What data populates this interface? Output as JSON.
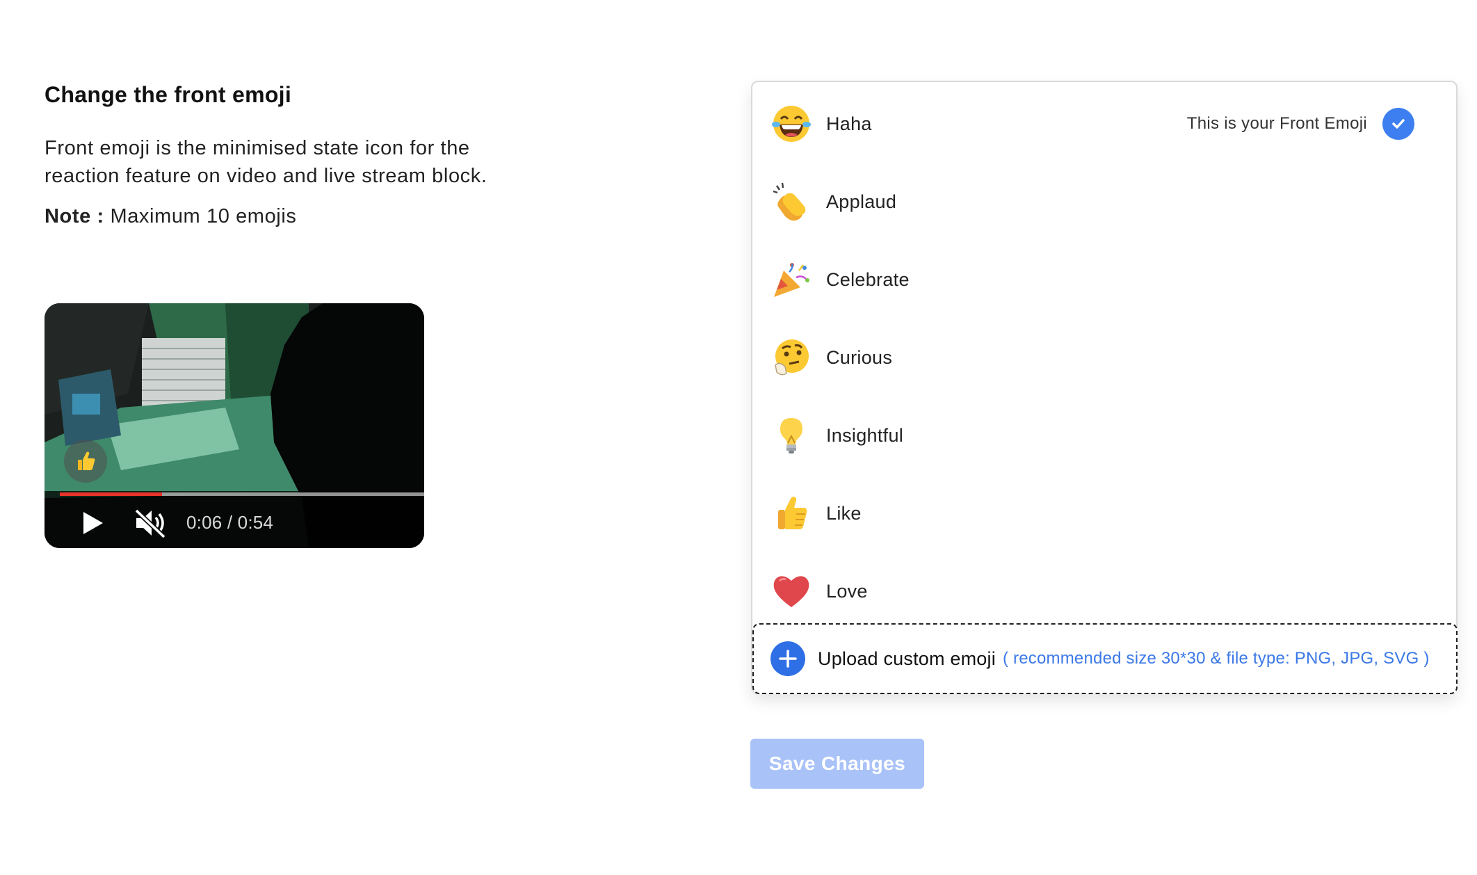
{
  "section": {
    "title": "Change the front emoji",
    "description": "Front emoji is the minimised state icon for the reaction feature on video and live stream block.",
    "note_label": "Note :",
    "note_text": "Maximum 10 emojis"
  },
  "video": {
    "current_time": "0:06",
    "duration": "0:54",
    "time_display": "0:06 / 0:54",
    "progress": 0.28,
    "progress_color": "#e8332b",
    "reaction_icon": "thumbs-up-icon",
    "play_icon": "play-icon",
    "mute_icon": "muted-icon"
  },
  "emojis": [
    {
      "label": "Haha",
      "icon": "laughing-tears-icon",
      "selected": true
    },
    {
      "label": "Applaud",
      "icon": "clapping-hands-icon",
      "selected": false
    },
    {
      "label": "Celebrate",
      "icon": "party-popper-icon",
      "selected": false
    },
    {
      "label": "Curious",
      "icon": "thinking-face-icon",
      "selected": false
    },
    {
      "label": "Insightful",
      "icon": "light-bulb-icon",
      "selected": false
    },
    {
      "label": "Like",
      "icon": "thumbs-up-icon",
      "selected": false
    },
    {
      "label": "Love",
      "icon": "heart-icon",
      "selected": false
    }
  ],
  "front_emoji_note": "This is your Front Emoji",
  "upload": {
    "label": "Upload custom emoji",
    "hint": "( recommended size 30*30 & file type: PNG, JPG, SVG )",
    "icon": "plus-icon"
  },
  "actions": {
    "save_label": "Save Changes"
  },
  "colors": {
    "accent": "#3d7ef0",
    "save_button_disabled": "#a9c2f7",
    "hint_text": "#3b78e7"
  }
}
